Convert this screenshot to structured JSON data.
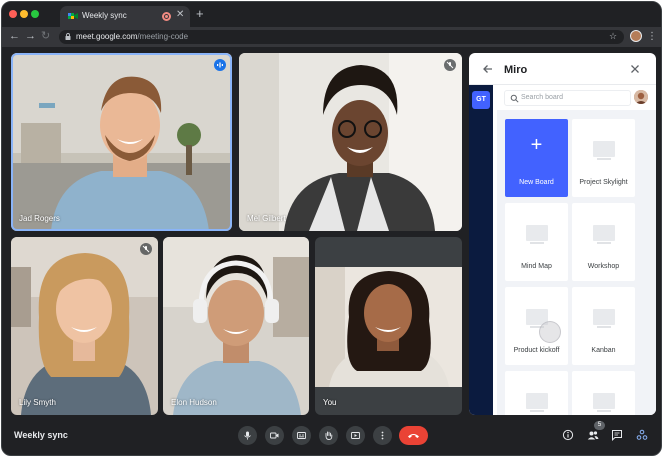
{
  "browser": {
    "tab_title": "Weekly sync",
    "url_host": "meet.google.com",
    "url_path": "/meeting-code",
    "icons": [
      "back-arrow-icon",
      "forward-arrow-icon",
      "reload-icon",
      "lock-icon",
      "star-icon",
      "kebab-menu-icon",
      "close-icon",
      "plus-icon",
      "recording-icon"
    ]
  },
  "participants": [
    {
      "name": "Jad Rogers",
      "speaking": true
    },
    {
      "name": "Mel Gilbert",
      "muted": true
    },
    {
      "name": "Lily Smyth",
      "muted": true
    },
    {
      "name": "Elon Hudson",
      "muted": false
    },
    {
      "name": "You",
      "muted": false
    }
  ],
  "miro_panel": {
    "title": "Miro",
    "rail_avatar": "GT",
    "search_placeholder": "Search board",
    "new_board_label": "New Board",
    "boards": [
      "Project Skylight",
      "Mind Map",
      "Workshop",
      "Product kickoff",
      "Kanban"
    ]
  },
  "bottom_bar": {
    "meeting_title": "Weekly sync",
    "people_count": "5",
    "hangup_color": "#ea4335"
  },
  "colors": {
    "accent": "#1a73e8",
    "miro_blue": "#4262ff",
    "background": "#202124"
  }
}
